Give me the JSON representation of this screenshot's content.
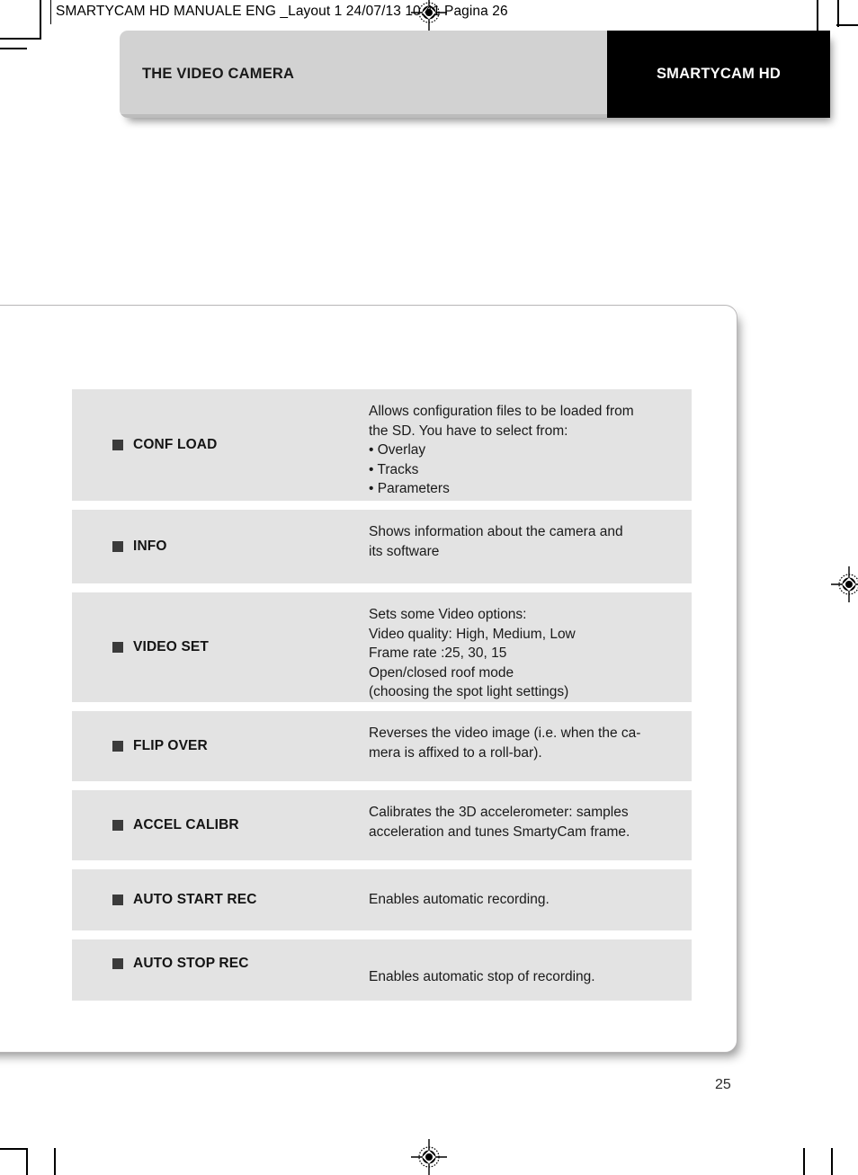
{
  "print_header": {
    "text": "SMARTYCAM HD MANUALE ENG _Layout 1  24/07/13  10.41  Pagina 26"
  },
  "banner": {
    "section_title": "THE VIDEO CAMERA",
    "brand": "SMARTYCAM HD",
    "left_bg": "#d2d2d2",
    "right_bg": "#000000"
  },
  "table": {
    "row_bg": "#e3e3e3",
    "bullet_color": "#3b3b3b",
    "rows": [
      {
        "label": "CONF LOAD",
        "lines": [
          "Allows configuration files to be loaded from",
          "the SD. You have to select from:",
          "• Overlay",
          "• Tracks",
          "• Parameters"
        ]
      },
      {
        "label": "INFO",
        "lines": [
          "Shows information about the camera and",
          "its software"
        ]
      },
      {
        "label": "VIDEO SET",
        "lines": [
          "Sets some Video options:",
          "Video quality: High, Medium, Low",
          "Frame rate :25, 30, 15",
          "Open/closed roof mode",
          "(choosing the spot light settings)"
        ]
      },
      {
        "label": "FLIP OVER",
        "lines": [
          "Reverses the video image (i.e. when the ca-",
          "mera is affixed to a roll-bar)."
        ]
      },
      {
        "label": "ACCEL CALIBR",
        "lines": [
          "Calibrates the 3D accelerometer: samples",
          "acceleration and tunes SmartyCam frame."
        ]
      },
      {
        "label": "AUTO START REC",
        "lines": [
          "Enables automatic recording."
        ]
      },
      {
        "label": "AUTO STOP REC",
        "lines": [
          "Enables automatic stop of recording."
        ]
      }
    ]
  },
  "footer": {
    "page_number": "25"
  }
}
